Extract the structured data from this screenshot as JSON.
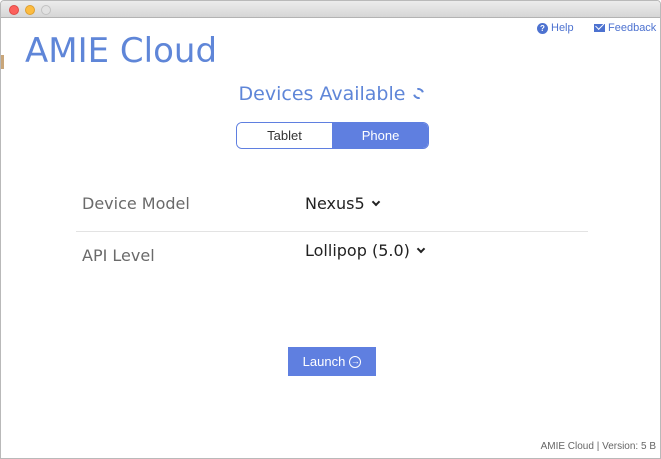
{
  "window": {
    "controls": [
      "close",
      "minimize",
      "maximize"
    ]
  },
  "header": {
    "help_label": "Help",
    "help_icon": "help-circle-icon",
    "feedback_label": "Feedback",
    "feedback_icon": "envelope-icon"
  },
  "app": {
    "title": "AMIE Cloud"
  },
  "devices": {
    "title": "Devices Available",
    "refresh_icon": "refresh-icon",
    "tabs": [
      {
        "label": "Tablet",
        "selected": false
      },
      {
        "label": "Phone",
        "selected": true
      }
    ]
  },
  "form": {
    "device_model_label": "Device Model",
    "device_model_value": "Nexus5",
    "api_level_label": "API Level",
    "api_level_value": "Lollipop (5.0)"
  },
  "actions": {
    "launch_label": "Launch",
    "launch_icon": "arrow-right-circle-icon"
  },
  "footer": {
    "version_text": "AMIE Cloud | Version: 5 B"
  },
  "colors": {
    "accent": "#5f7fe0",
    "title_blue": "#5f86d8",
    "link_blue": "#4d72d0"
  }
}
